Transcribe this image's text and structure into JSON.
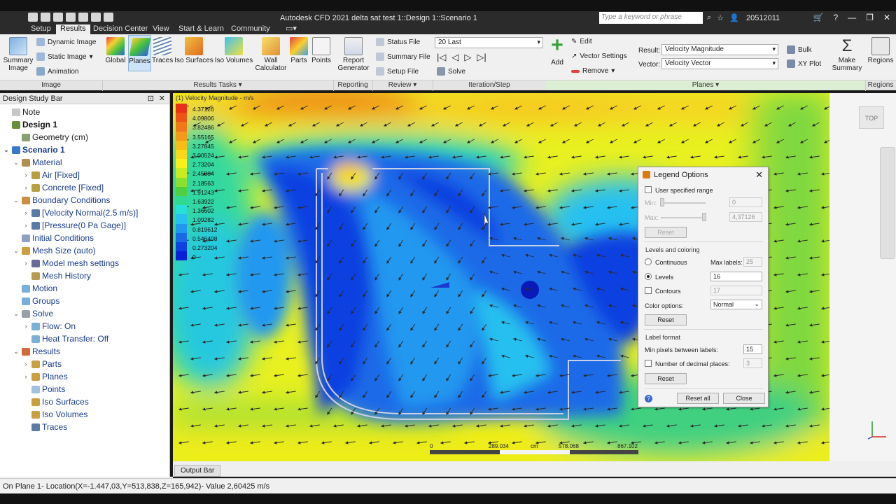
{
  "window": {
    "title": "Autodesk CFD 2021   delta sat test 1::Design 1::Scenario 1",
    "search_placeholder": "Type a keyword or phrase",
    "user": "20512011"
  },
  "menu": [
    "Setup",
    "Results",
    "Decision Center",
    "View",
    "Start & Learn",
    "Community"
  ],
  "menu_active": "Results",
  "ribbon": {
    "summary_image": "Summary Image",
    "dynamic_image": "Dynamic Image",
    "static_image": "Static Image",
    "animation": "Animation",
    "global": "Global",
    "planes": "Planes",
    "traces": "Traces",
    "iso_surfaces": "Iso Surfaces",
    "iso_volumes": "Iso Volumes",
    "wall_calculator": "Wall Calculator",
    "parts": "Parts",
    "points": "Points",
    "report_generator": "Report Generator",
    "status_file": "Status File",
    "summary_file": "Summary File",
    "setup_file": "Setup File",
    "iteration_select": "20 Last",
    "solve": "Solve",
    "add": "Add",
    "edit": "Edit",
    "vector_settings": "Vector Settings",
    "remove": "Remove",
    "result_label": "Result:",
    "result_value": "Velocity Magnitude",
    "vector_label": "Vector:",
    "vector_value": "Velocity Vector",
    "bulk": "Bulk",
    "xy_plot": "XY Plot",
    "make_summary": "Make Summary",
    "regions": "Regions",
    "groups": {
      "image": "Image",
      "results_tasks": "Results Tasks",
      "reporting": "Reporting",
      "review": "Review",
      "iteration_step": "Iteration/Step",
      "planes": "Planes",
      "regions": "Regions"
    }
  },
  "sidebar": {
    "title": "Design Study Bar",
    "items": [
      {
        "label": "Note",
        "level": 0,
        "arrow": "",
        "style": "dark",
        "color": "#c8c8c8"
      },
      {
        "label": "Design 1",
        "level": 0,
        "arrow": "",
        "style": "bold",
        "color": "#6a8f3b"
      },
      {
        "label": "Geometry (cm)",
        "level": 1,
        "arrow": "",
        "style": "dark",
        "color": "#8aa070"
      },
      {
        "label": "Scenario 1",
        "level": 0,
        "arrow": "v",
        "style": "boldblue",
        "color": "#3a79c8"
      },
      {
        "label": "Material",
        "level": 1,
        "arrow": "v",
        "style": "",
        "color": "#b09050"
      },
      {
        "label": "Air [Fixed]",
        "level": 2,
        "arrow": ">",
        "style": "",
        "color": "#b8a040"
      },
      {
        "label": "Concrete [Fixed]",
        "level": 2,
        "arrow": ">",
        "style": "",
        "color": "#b8a040"
      },
      {
        "label": "Boundary Conditions",
        "level": 1,
        "arrow": "v",
        "style": "",
        "color": "#c89040"
      },
      {
        "label": "[Velocity Normal(2.5 m/s)]",
        "level": 2,
        "arrow": ">",
        "style": "",
        "color": "#5a7aa8"
      },
      {
        "label": "[Pressure(0 Pa Gage)]",
        "level": 2,
        "arrow": ">",
        "style": "",
        "color": "#5a7aa8"
      },
      {
        "label": "Initial Conditions",
        "level": 1,
        "arrow": "",
        "style": "",
        "color": "#90a0c0"
      },
      {
        "label": "Mesh Size (auto)",
        "level": 1,
        "arrow": "v",
        "style": "",
        "color": "#c8a040"
      },
      {
        "label": "Model mesh settings",
        "level": 2,
        "arrow": ">",
        "style": "",
        "color": "#6a6a9a"
      },
      {
        "label": "Mesh History",
        "level": 2,
        "arrow": "",
        "style": "",
        "color": "#b89a50"
      },
      {
        "label": "Motion",
        "level": 1,
        "arrow": "",
        "style": "",
        "color": "#7ab0d8"
      },
      {
        "label": "Groups",
        "level": 1,
        "arrow": "",
        "style": "",
        "color": "#7ab0d8"
      },
      {
        "label": "Solve",
        "level": 1,
        "arrow": "v",
        "style": "",
        "color": "#9aa0aa"
      },
      {
        "label": "Flow: On",
        "level": 2,
        "arrow": ">",
        "style": "",
        "color": "#7ab0d8"
      },
      {
        "label": "Heat Transfer: Off",
        "level": 2,
        "arrow": "",
        "style": "",
        "color": "#7ab0d8"
      },
      {
        "label": "Results",
        "level": 1,
        "arrow": "v",
        "style": "",
        "color": "#d06a3a"
      },
      {
        "label": "Parts",
        "level": 2,
        "arrow": ">",
        "style": "",
        "color": "#c8a040"
      },
      {
        "label": "Planes",
        "level": 2,
        "arrow": ">",
        "style": "",
        "color": "#c8a040"
      },
      {
        "label": "Points",
        "level": 2,
        "arrow": "",
        "style": "",
        "color": "#a0c0e0"
      },
      {
        "label": "Iso Surfaces",
        "level": 2,
        "arrow": "",
        "style": "",
        "color": "#c8a040"
      },
      {
        "label": "Iso Volumes",
        "level": 2,
        "arrow": "",
        "style": "",
        "color": "#c8a040"
      },
      {
        "label": "Traces",
        "level": 2,
        "arrow": "",
        "style": "",
        "color": "#5a7aa8"
      }
    ]
  },
  "legend": {
    "title": "(1) Velocity Magnitude - m/s",
    "levels": [
      {
        "value": "4.37126",
        "color": "#e8301a"
      },
      {
        "value": "4.09806",
        "color": "#ec5418"
      },
      {
        "value": "3.82486",
        "color": "#f07818"
      },
      {
        "value": "3.55165",
        "color": "#f49a18"
      },
      {
        "value": "3.27845",
        "color": "#f8bc18"
      },
      {
        "value": "3.00524",
        "color": "#fbd818"
      },
      {
        "value": "2.73204",
        "color": "#f8f018"
      },
      {
        "value": "2.45884",
        "color": "#c8ec20"
      },
      {
        "value": "2.18563",
        "color": "#8ce030"
      },
      {
        "value": "1.91243",
        "color": "#50d040"
      },
      {
        "value": "1.63922",
        "color": "#30d890"
      },
      {
        "value": "1.36602",
        "color": "#28e0d8"
      },
      {
        "value": "1.09282",
        "color": "#28c0f0"
      },
      {
        "value": "0.819612",
        "color": "#2098f0"
      },
      {
        "value": "0.546408",
        "color": "#1a6ae8"
      },
      {
        "value": "0.273204",
        "color": "#1040e0"
      },
      {
        "value": "0",
        "color": "#0820d8"
      }
    ]
  },
  "scale": {
    "t0": "0",
    "t1": "289.034",
    "unit": "cm",
    "t2": "578.068",
    "t3": "867.102"
  },
  "viewcube": "TOP",
  "dialog": {
    "title": "Legend Options",
    "user_range": "User specified range",
    "min_label": "Min:",
    "min_value": "0",
    "max_label": "Max:",
    "max_value": "4,37126",
    "reset": "Reset",
    "levels_coloring": "Levels and coloring",
    "continuous": "Continuous",
    "max_labels_label": "Max labels:",
    "max_labels_value": "25",
    "levels": "Levels",
    "levels_value": "16",
    "contours": "Contours",
    "contours_value": "17",
    "color_options_label": "Color options:",
    "color_options_value": "Normal",
    "label_format": "Label format",
    "min_pixels_label": "Min pixels between labels:",
    "min_pixels_value": "15",
    "decimal_places": "Number of decimal places:",
    "decimal_value": "3",
    "reset_all": "Reset all",
    "close": "Close"
  },
  "output_bar": "Output Bar",
  "status": "On Plane 1- Location(X=-1.447,03,Y=513,838,Z=165,942)- Value  2,60425  m/s"
}
